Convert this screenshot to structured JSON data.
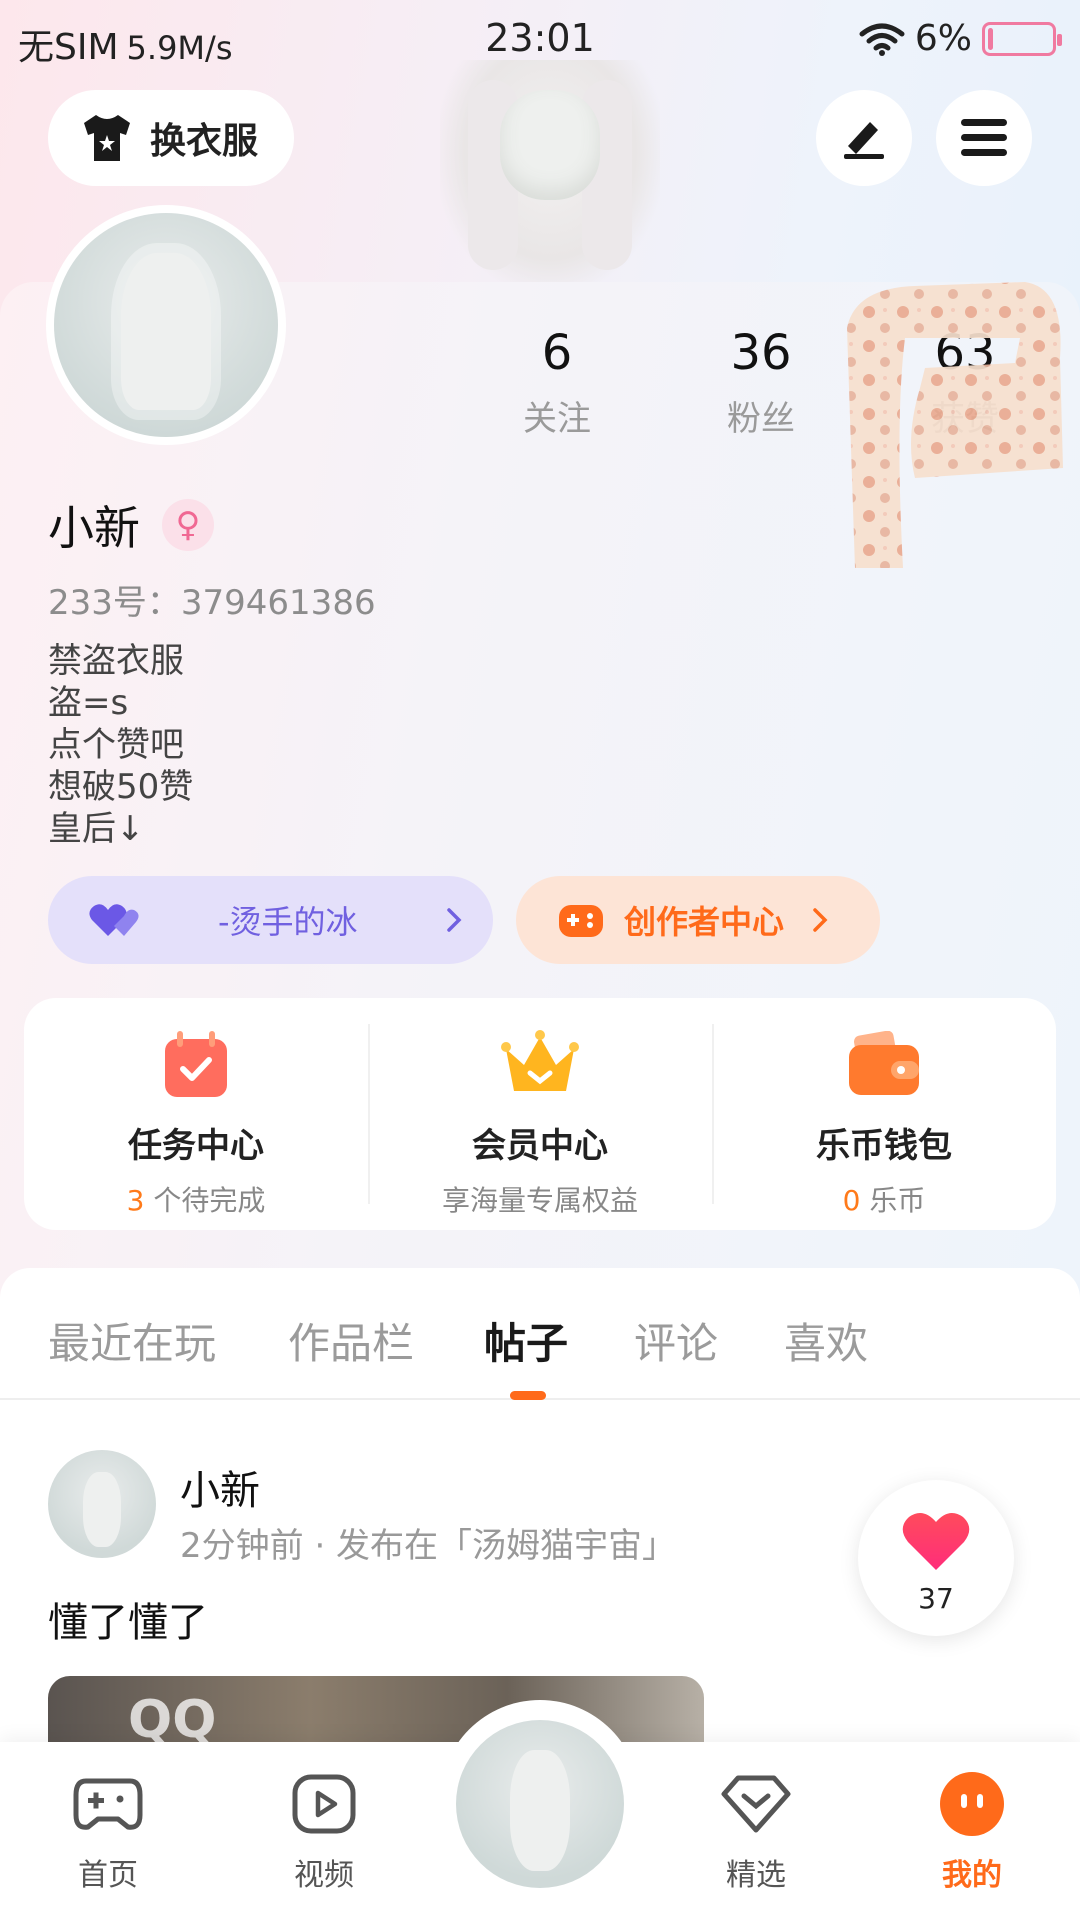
{
  "status_bar": {
    "carrier": "无SIM",
    "speed": "5.9M/s",
    "time": "23:01",
    "battery": "6%"
  },
  "header": {
    "outfit_label": "换衣服"
  },
  "profile": {
    "stats": [
      {
        "value": "6",
        "label": "关注"
      },
      {
        "value": "36",
        "label": "粉丝"
      },
      {
        "value": "63",
        "label": "获赞"
      }
    ],
    "name": "小新",
    "gender_symbol": "♀",
    "uid": "233号：379461386",
    "bio": [
      "禁盗衣服",
      "盗=s",
      "点个赞吧",
      "想破50赞",
      "皇后↓"
    ],
    "partner_label": "-烫手的冰",
    "creator_label": "创作者中心"
  },
  "features": [
    {
      "title": "任务中心",
      "highlight": "3",
      "sub": " 个待完成",
      "icon": "calendar-check-icon"
    },
    {
      "title": "会员中心",
      "highlight": "",
      "sub": "享海量专属权益",
      "icon": "crown-icon"
    },
    {
      "title": "乐币钱包",
      "highlight": "0",
      "sub": " 乐币",
      "icon": "wallet-icon"
    }
  ],
  "tabs": [
    "最近在玩",
    "作品栏",
    "帖子",
    "评论",
    "喜欢"
  ],
  "active_tab": "帖子",
  "post": {
    "author": "小新",
    "meta": "2分钟前 · 发布在「汤姆猫宇宙」",
    "content": "懂了懂了",
    "likes": "37",
    "image_text": "QQ"
  },
  "bottom_nav": [
    "首页",
    "视频",
    "精选",
    "我的"
  ],
  "colors": {
    "accent": "#ff6a1a",
    "purple": "#7060e0",
    "pink": "#f06893"
  }
}
